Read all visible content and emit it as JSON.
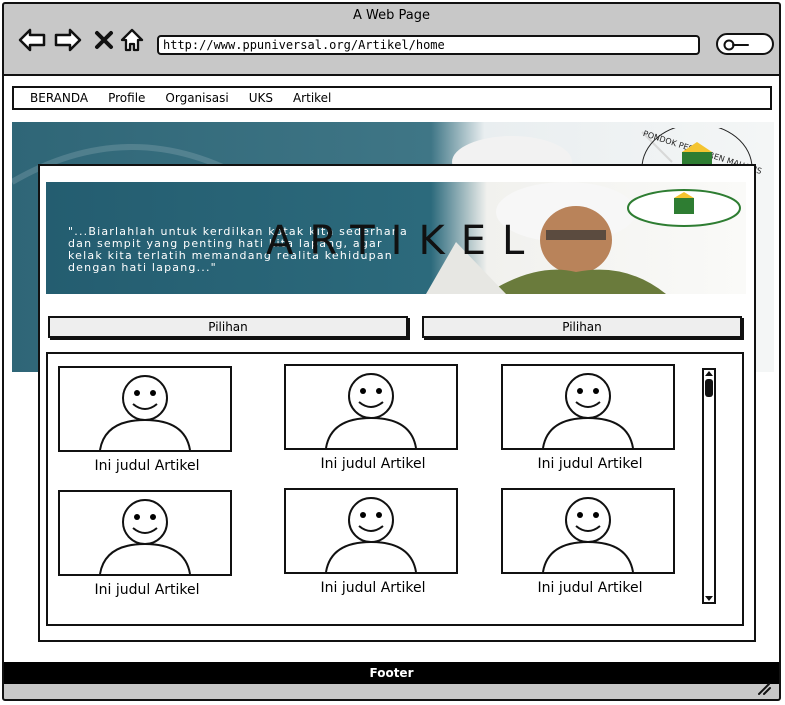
{
  "window": {
    "title": "A Web Page",
    "url": "http://www.ppuniversal.org/Artikel/home"
  },
  "menu": {
    "items": [
      "BERANDA",
      "Profile",
      "Organisasi",
      "UKS",
      "Artikel"
    ]
  },
  "banner": {
    "title": "ARTIKEL",
    "quote": "\"...Biarlahlah untuk kerdilkan kotak kita sederhana dan sempit yang penting hati kita lapang, agar kelak kita terlatih memandang realita kehidupan dengan hati lapang...\""
  },
  "filters": {
    "left_label": "Pilihan",
    "right_label": "Pilihan"
  },
  "articles": [
    {
      "title": "Ini judul Artikel"
    },
    {
      "title": "Ini judul Artikel"
    },
    {
      "title": "Ini judul Artikel"
    },
    {
      "title": "Ini judul Artikel"
    },
    {
      "title": "Ini judul Artikel"
    },
    {
      "title": "Ini judul Artikel"
    }
  ],
  "footer": {
    "label": "Footer"
  },
  "colors": {
    "hero_teal": "#2f6677",
    "footer_bg": "#000000",
    "chrome_gray": "#c8c8c8"
  }
}
